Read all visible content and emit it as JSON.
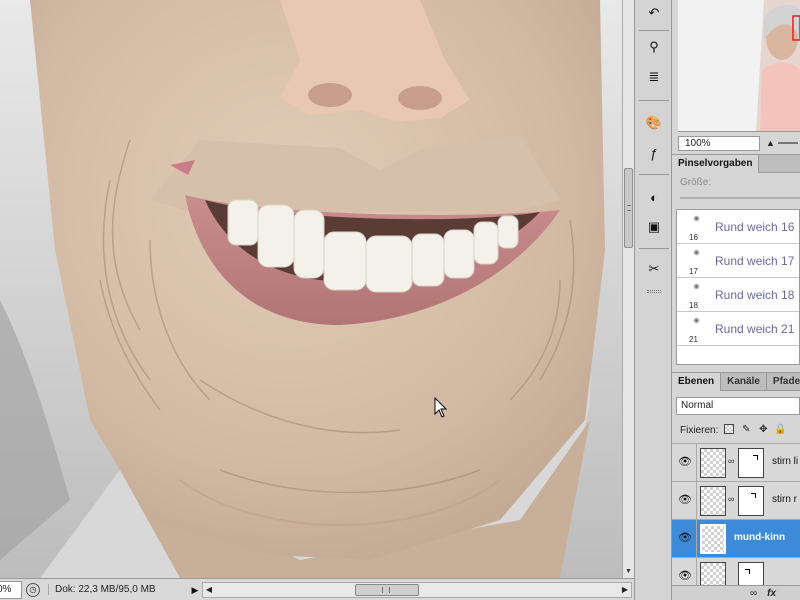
{
  "status": {
    "zoom": "0%",
    "doc": "Dok: 22,3 MB/95,0 MB"
  },
  "navigator": {
    "zoom": "100%"
  },
  "brush_panel": {
    "tab": "Pinselvorgaben",
    "size_label": "Größe:",
    "presets": [
      {
        "num": "16",
        "name": "Rund weich 16"
      },
      {
        "num": "17",
        "name": "Rund weich 17"
      },
      {
        "num": "18",
        "name": "Rund weich 18"
      },
      {
        "num": "21",
        "name": "Rund weich 21"
      }
    ]
  },
  "layers_panel": {
    "tabs": [
      "Ebenen",
      "Kanäle",
      "Pfade"
    ],
    "blend_mode": "Normal",
    "lock_label": "Fixieren:",
    "layers": [
      {
        "name": "stirn li",
        "selected": false
      },
      {
        "name": "stirn r",
        "selected": false
      },
      {
        "name": "mund-kinn",
        "selected": true
      }
    ],
    "footer_fx": "fx"
  },
  "tools": {
    "icons": [
      "history-brush-icon",
      "clone-stamp-icon",
      "stamp-icon",
      "palette-icon",
      "fx-icon",
      "dodge-icon",
      "mask-icon",
      "tools-icon"
    ]
  },
  "colors": {
    "selection": "#3d8bd8",
    "panel_bg": "#d6d6d6",
    "skin": "#d7bfa9"
  }
}
